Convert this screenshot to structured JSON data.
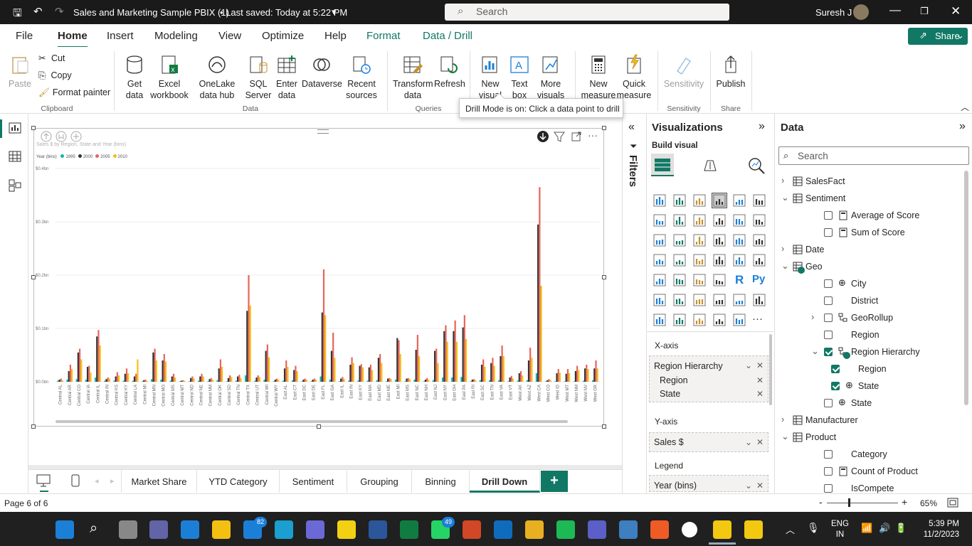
{
  "window": {
    "title": "Sales and Marketing Sample PBIX (1)",
    "saved": "• Last saved: Today at 5:22 PM",
    "search": "Search",
    "user": "Suresh J"
  },
  "menu": [
    "File",
    "Home",
    "Insert",
    "Modeling",
    "View",
    "Optimize",
    "Help",
    "Format",
    "Data / Drill"
  ],
  "share": "Share",
  "ribbon": {
    "clipboard": {
      "paste": "Paste",
      "cut": "Cut",
      "copy": "Copy",
      "painter": "Format painter",
      "group": "Clipboard"
    },
    "data": {
      "get": "Get data",
      "excel": "Excel workbook",
      "onelake": "OneLake data hub",
      "sql": "SQL Server",
      "enter": "Enter data",
      "dataverse": "Dataverse",
      "recent": "Recent sources",
      "group": "Data"
    },
    "queries": {
      "transform": "Transform data",
      "refresh": "Refresh",
      "group": "Queries"
    },
    "insert": {
      "newvisual": "New visual",
      "textbox": "Text box",
      "more": "More visuals"
    },
    "calc": {
      "measure": "New measure",
      "quick": "Quick measure"
    },
    "sens": {
      "label": "Sensitivity",
      "group": "Sensitivity"
    },
    "share": {
      "publish": "Publish",
      "group": "Share"
    }
  },
  "tooltip": "Drill Mode is on: Click a data point to drill",
  "chart_data": {
    "type": "bar",
    "title": "Sales $ by Region, State and Year (bins)",
    "legend_title": "Year (bins)",
    "legend_position": "top-left",
    "grid": true,
    "ylim": [
      0,
      0.4
    ],
    "ytick_labels": [
      "$0.0bn",
      "$0.1bn",
      "$0.2bn",
      "$0.3bn",
      "$0.4bn"
    ],
    "categories": [
      "Central AL",
      "Central AR",
      "Central CO",
      "Central IA",
      "Central IL",
      "Central IN",
      "Central KS",
      "Central KY",
      "Central LA",
      "Central MI",
      "Central MN",
      "Central MO",
      "Central MS",
      "Central MT",
      "Central ND",
      "Central NE",
      "Central NM",
      "Central OK",
      "Central SD",
      "Central TN",
      "Central TX",
      "Central UT",
      "Central WI",
      "Central WY",
      "East AL",
      "East CT",
      "East DC",
      "East DE",
      "East FL",
      "East GA",
      "East IL",
      "East IN",
      "East KY",
      "East MA",
      "East MD",
      "East ME",
      "East MI",
      "East MS",
      "East NC",
      "East NH",
      "East NJ",
      "East NY",
      "East OH",
      "East PA",
      "East RI",
      "East SC",
      "East TN",
      "East VA",
      "East VT",
      "West AK",
      "West AZ",
      "West CA",
      "West CO",
      "West ID",
      "West MT",
      "West NM",
      "West NV",
      "West OR"
    ],
    "series": [
      {
        "name": "1995",
        "color": "#12b5a5",
        "values": [
          0.002,
          0.004,
          0.005,
          0.004,
          0.008,
          0.002,
          0.002,
          0.002,
          0.002,
          0.001,
          0.005,
          0.004,
          0.002,
          0.001,
          0.001,
          0.002,
          0.001,
          0.003,
          0.001,
          0.002,
          0.012,
          0.002,
          0.004,
          0.001,
          0.002,
          0.003,
          0.001,
          0.001,
          0.01,
          0.004,
          0.001,
          0.002,
          0.002,
          0.002,
          0.003,
          0.001,
          0.004,
          0.001,
          0.004,
          0.001,
          0.003,
          0.008,
          0.008,
          0.009,
          0.001,
          0.003,
          0.003,
          0.003,
          0.001,
          0.002,
          0.003,
          0.016,
          0.001,
          0.001,
          0.001,
          0.001,
          0.002,
          0.003
        ]
      },
      {
        "name": "2000",
        "color": "#333333",
        "values": [
          0.004,
          0.02,
          0.055,
          0.028,
          0.085,
          0.005,
          0.01,
          0.015,
          0.01,
          0.003,
          0.055,
          0.04,
          0.01,
          0.002,
          0.007,
          0.01,
          0.005,
          0.025,
          0.007,
          0.01,
          0.133,
          0.008,
          0.058,
          0.004,
          0.025,
          0.022,
          0.004,
          0.004,
          0.13,
          0.058,
          0.006,
          0.032,
          0.03,
          0.027,
          0.045,
          0.006,
          0.082,
          0.006,
          0.06,
          0.004,
          0.058,
          0.095,
          0.095,
          0.102,
          0.004,
          0.032,
          0.035,
          0.048,
          0.008,
          0.016,
          0.04,
          0.295,
          0.003,
          0.016,
          0.015,
          0.02,
          0.025,
          0.025
        ]
      },
      {
        "name": "2005",
        "color": "#e8645a",
        "values": [
          0.006,
          0.032,
          0.062,
          0.03,
          0.097,
          0.008,
          0.018,
          0.025,
          0.015,
          0.004,
          0.062,
          0.052,
          0.015,
          0.003,
          0.01,
          0.015,
          0.007,
          0.042,
          0.012,
          0.013,
          0.2,
          0.012,
          0.07,
          0.006,
          0.04,
          0.03,
          0.006,
          0.006,
          0.211,
          0.092,
          0.009,
          0.046,
          0.033,
          0.032,
          0.052,
          0.007,
          0.078,
          0.007,
          0.088,
          0.007,
          0.062,
          0.106,
          0.115,
          0.125,
          0.005,
          0.042,
          0.045,
          0.068,
          0.011,
          0.02,
          0.064,
          0.365,
          0.005,
          0.024,
          0.024,
          0.03,
          0.032,
          0.04
        ]
      },
      {
        "name": "2010",
        "color": "#f3c012",
        "values": [
          0.003,
          0.024,
          0.042,
          0.017,
          0.068,
          0.006,
          0.012,
          0.016,
          0.042,
          0.002,
          0.04,
          0.038,
          0.008,
          0.002,
          0.006,
          0.01,
          0.004,
          0.028,
          0.009,
          0.007,
          0.143,
          0.009,
          0.046,
          0.004,
          0.028,
          0.02,
          0.004,
          0.004,
          0.125,
          0.045,
          0.005,
          0.035,
          0.027,
          0.022,
          0.035,
          0.005,
          0.052,
          0.005,
          0.048,
          0.004,
          0.035,
          0.075,
          0.075,
          0.08,
          0.003,
          0.028,
          0.03,
          0.048,
          0.006,
          0.012,
          0.045,
          0.18,
          0.003,
          0.017,
          0.016,
          0.022,
          0.024,
          0.025
        ]
      }
    ]
  },
  "visualizations": {
    "title": "Visualizations",
    "build": "Build visual",
    "xaxis_label": "X-axis",
    "xaxis": [
      "Region Hierarchy",
      "Region",
      "State"
    ],
    "yaxis_label": "Y-axis",
    "yaxis": [
      "Sales $"
    ],
    "legend_label": "Legend",
    "legend": [
      "Year (bins)"
    ]
  },
  "filters_label": "Filters",
  "data_pane": {
    "title": "Data",
    "search": "Search",
    "items": [
      "SalesFact",
      "Sentiment",
      "Average of Score",
      "Sum of Score",
      "Date",
      "Geo",
      "City",
      "District",
      "GeoRollup",
      "Region",
      "Region Hierarchy",
      "Region",
      "State",
      "State",
      "Manufacturer",
      "Product",
      "Category",
      "Count of Product",
      "IsCompete"
    ]
  },
  "pages": [
    "Market Share",
    "YTD Category",
    "Sentiment",
    "Grouping",
    "Binning",
    "Drill Down"
  ],
  "status": {
    "page": "Page 6 of 6",
    "zoom": "65%"
  },
  "taskbar": {
    "lang1": "ENG",
    "lang2": "IN",
    "time": "5:39 PM",
    "date": "11/2/2023",
    "badge1": "82",
    "badge2": "49"
  }
}
